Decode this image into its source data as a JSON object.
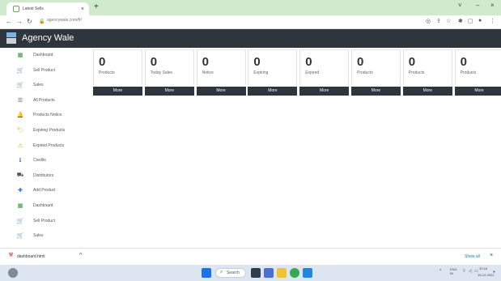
{
  "browser": {
    "tab_title": "Latest Sells",
    "tab_close": "×",
    "new_tab": "+",
    "url": "agencywale.com/fr/",
    "window": {
      "chevron": "˅",
      "minimize": "–",
      "close": "×"
    }
  },
  "app": {
    "title": "Agency Wale"
  },
  "sidebar": {
    "items": [
      {
        "label": "Dashboard",
        "icon": "dashboard-icon",
        "glyph": "▦",
        "color": "#2f8f2f"
      },
      {
        "label": "Sell Product",
        "icon": "cart-icon",
        "glyph": "🛒",
        "color": "#2e9e44"
      },
      {
        "label": "Sales",
        "icon": "cart-icon",
        "glyph": "🛒",
        "color": "#2e9e44"
      },
      {
        "label": "All Products",
        "icon": "list-icon",
        "glyph": "☰",
        "color": "#1a6fd1"
      },
      {
        "label": "Products Notice",
        "icon": "bell-icon",
        "glyph": "🔔",
        "color": "#f0a500"
      },
      {
        "label": "Expiring Products",
        "icon": "tag-icon",
        "glyph": "🏷",
        "color": "#e0a000"
      },
      {
        "label": "Expired Products",
        "icon": "warning-icon",
        "glyph": "⚠",
        "color": "#e8a000"
      },
      {
        "label": "Credits",
        "icon": "info-icon",
        "glyph": "ℹ",
        "color": "#1a6fd1"
      },
      {
        "label": "Distributors",
        "icon": "distributor-icon",
        "glyph": "⛟",
        "color": "#555555"
      },
      {
        "label": "Add Product",
        "icon": "add-product-icon",
        "glyph": "✚",
        "color": "#1a6fd1"
      },
      {
        "label": "Dashboard",
        "icon": "dashboard-icon",
        "glyph": "▦",
        "color": "#2f8f2f"
      },
      {
        "label": "Sell Product",
        "icon": "cart-icon",
        "glyph": "🛒",
        "color": "#2e9e44"
      },
      {
        "label": "Sales",
        "icon": "cart-icon",
        "glyph": "🛒",
        "color": "#2e9e44"
      }
    ]
  },
  "cards": [
    {
      "value": "0",
      "label": "Products",
      "more": "More"
    },
    {
      "value": "0",
      "label": "Today Sales",
      "more": "More"
    },
    {
      "value": "0",
      "label": "Notice",
      "more": "More"
    },
    {
      "value": "0",
      "label": "Expiring",
      "more": "More"
    },
    {
      "value": "0",
      "label": "Expired",
      "more": "More"
    },
    {
      "value": "0",
      "label": "Products",
      "more": "More"
    },
    {
      "value": "0",
      "label": "Products",
      "more": "More"
    },
    {
      "value": "0",
      "label": "Products",
      "more": "More"
    }
  ],
  "download_bar": {
    "file_name": "dashboard.html",
    "show_all": "Show all"
  },
  "taskbar": {
    "search_label": "Search",
    "lang": "ENG\nIN",
    "time": "10:16",
    "date": "15-12-2022"
  },
  "colors": {
    "header_bg": "#2e353d",
    "tab_strip": "#cfeacd",
    "accent": "#1a73e8"
  }
}
